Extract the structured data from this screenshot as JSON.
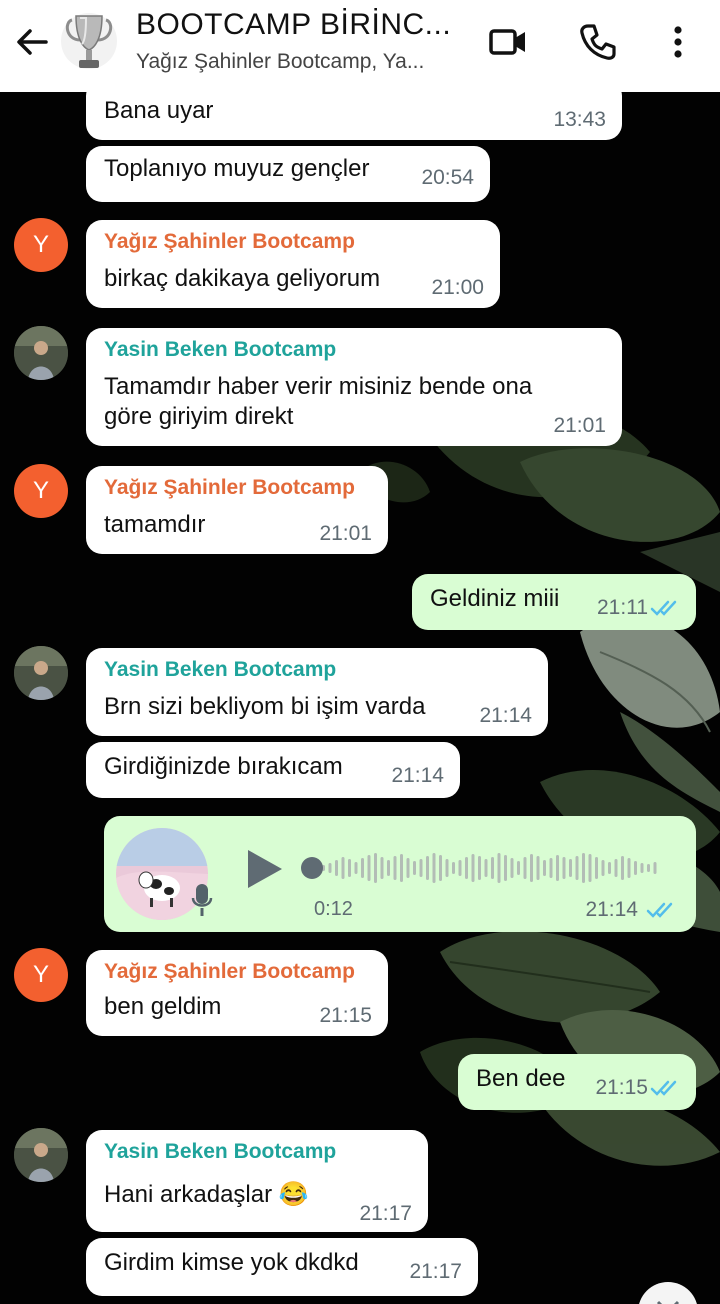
{
  "header": {
    "title": "BOOTCAMP BİRİNC...",
    "subtitle": "Yağız Şahinler Bootcamp, Ya..."
  },
  "colors": {
    "sender_orange": "#e36a3a",
    "sender_teal": "#1fa39b",
    "outgoing_bubble": "#d9fdd3",
    "tick_blue": "#53bdeb"
  },
  "messages": [
    {
      "text": "Bana uyar",
      "time": "13:43"
    },
    {
      "text": "Toplanıyo muyuz gençler",
      "time": "20:54"
    },
    {
      "sender": "Yağız Şahinler Bootcamp",
      "avatar_letter": "Y",
      "text": "birkaç dakikaya geliyorum",
      "time": "21:00"
    },
    {
      "sender": "Yasin Beken Bootcamp",
      "text1": "Tamamdır haber verir misiniz bende ona",
      "text2": "göre giriyim direkt",
      "time": "21:01"
    },
    {
      "sender": "Yağız Şahinler Bootcamp",
      "avatar_letter": "Y",
      "text": "tamamdır",
      "time": "21:01"
    },
    {
      "text": "Geldiniz miii",
      "time": "21:11"
    },
    {
      "sender": "Yasin Beken Bootcamp",
      "text": "Brn sizi bekliyom bi işim varda",
      "time": "21:14"
    },
    {
      "text": "Girdiğinizde bırakıcam",
      "time": "21:14"
    },
    {
      "duration": "0:12",
      "time": "21:14",
      "progress": 0
    },
    {
      "sender": "Yağız Şahinler Bootcamp",
      "avatar_letter": "Y",
      "text": "ben geldim",
      "time": "21:15"
    },
    {
      "text": "Ben dee",
      "time": "21:15"
    },
    {
      "sender": "Yasin Beken Bootcamp",
      "text": "Hani arkadaşlar 😂",
      "time": "21:17"
    },
    {
      "text": "Girdim kimse yok dkdkd",
      "time": "21:17"
    }
  ]
}
